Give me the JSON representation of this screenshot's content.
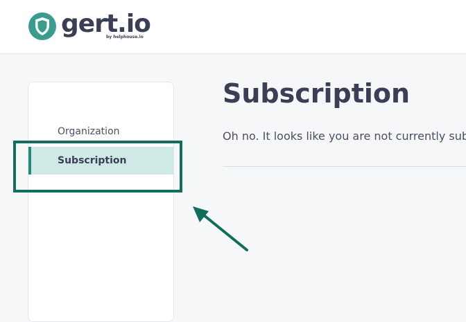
{
  "brand": {
    "name": "gert.io",
    "byline": "by helphouse.io",
    "logo_color": "#3a9c8e"
  },
  "sidebar": {
    "items": [
      {
        "label": "Organization",
        "active": false
      },
      {
        "label": "Subscription",
        "active": true
      }
    ]
  },
  "main": {
    "title": "Subscription",
    "message": "Oh no. It looks like you are not currently sub"
  },
  "annotation": {
    "highlight_color": "#0f6e5c",
    "arrow_color": "#0f6e5c"
  }
}
